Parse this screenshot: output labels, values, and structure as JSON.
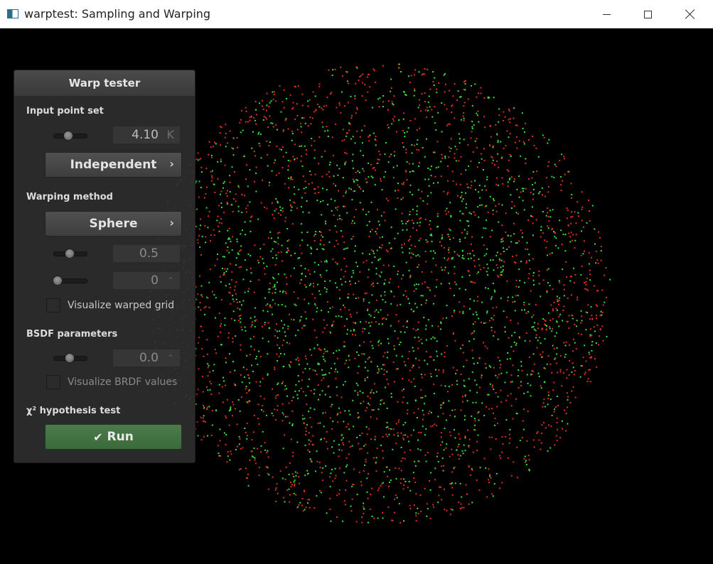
{
  "window": {
    "title": "warptest: Sampling and Warping"
  },
  "panel": {
    "title": "Warp tester",
    "input_point_set": {
      "label": "Input point set",
      "point_count": "4.10",
      "unit": "K",
      "slider_level": 0.45,
      "sampler": "Independent"
    },
    "warping_method": {
      "label": "Warping method",
      "method": "Sphere",
      "param1": "0.5",
      "param1_slider_level": 0.5,
      "param2": "0",
      "param2_slider_level": 0.0,
      "visualize_grid_label": "Visualize warped grid",
      "visualize_grid_checked": false
    },
    "bsdf": {
      "label": "BSDF parameters",
      "value": "0.0",
      "slider_level": 0.5,
      "visualize_brdf_label": "Visualize BRDF values",
      "visualize_brdf_checked": false
    },
    "hypothesis": {
      "label": "χ² hypothesis test",
      "run_label": "Run"
    }
  },
  "icons": {
    "app": "window-app-icon",
    "minimize": "minimize-icon",
    "maximize": "maximize-icon",
    "close": "close-icon",
    "chevron": "chevron-right-icon",
    "check": "check-icon"
  },
  "colors": {
    "point_inner": "#3ce03c",
    "point_outer": "#e03020",
    "run_button": "#3f6f3f"
  }
}
